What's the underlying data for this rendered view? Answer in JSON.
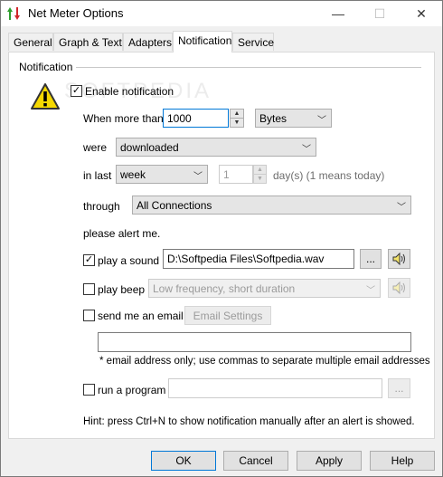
{
  "window": {
    "title": "Net Meter Options",
    "minimize_glyph": "—",
    "maximize_glyph": "☐",
    "close_glyph": "✕"
  },
  "tabs": [
    {
      "label": "General",
      "active": false
    },
    {
      "label": "Graph & Text",
      "active": false
    },
    {
      "label": "Adapters",
      "active": false
    },
    {
      "label": "Notification",
      "active": true
    },
    {
      "label": "Service",
      "active": false
    }
  ],
  "group": {
    "title": "Notification"
  },
  "watermark": "SOFTPEDIA",
  "enable_notification": {
    "label": "Enable notification",
    "checked": true,
    "mark": "✓"
  },
  "when_more_than": {
    "label": "When more than",
    "value": "1000",
    "unit": "Bytes"
  },
  "were": {
    "label": "were",
    "value": "downloaded"
  },
  "in_last": {
    "label": "in last",
    "period": "week",
    "days_value": "1",
    "days_hint": "day(s) (1 means today)"
  },
  "through": {
    "label": "through",
    "value": "All Connections"
  },
  "alert_text": "please alert me.",
  "play_sound": {
    "label": "play a sound",
    "checked": true,
    "mark": "✓",
    "path": "D:\\Softpedia Files\\Softpedia.wav",
    "browse": "...",
    "speaker_icon": "speaker-icon"
  },
  "play_beep": {
    "label": "play beep",
    "checked": false,
    "value": "Low frequency, short duration",
    "speaker_icon": "speaker-icon"
  },
  "send_email": {
    "label": "send me an email",
    "checked": false,
    "settings_button": "Email Settings",
    "address": "",
    "note": "* email address only; use commas to separate multiple email addresses"
  },
  "run_program": {
    "label": "run a program",
    "checked": false,
    "path": "",
    "browse": "..."
  },
  "hint": "Hint: press Ctrl+N to show notification manually after an alert is showed.",
  "footer": {
    "ok": "OK",
    "cancel": "Cancel",
    "apply": "Apply",
    "help": "Help"
  }
}
